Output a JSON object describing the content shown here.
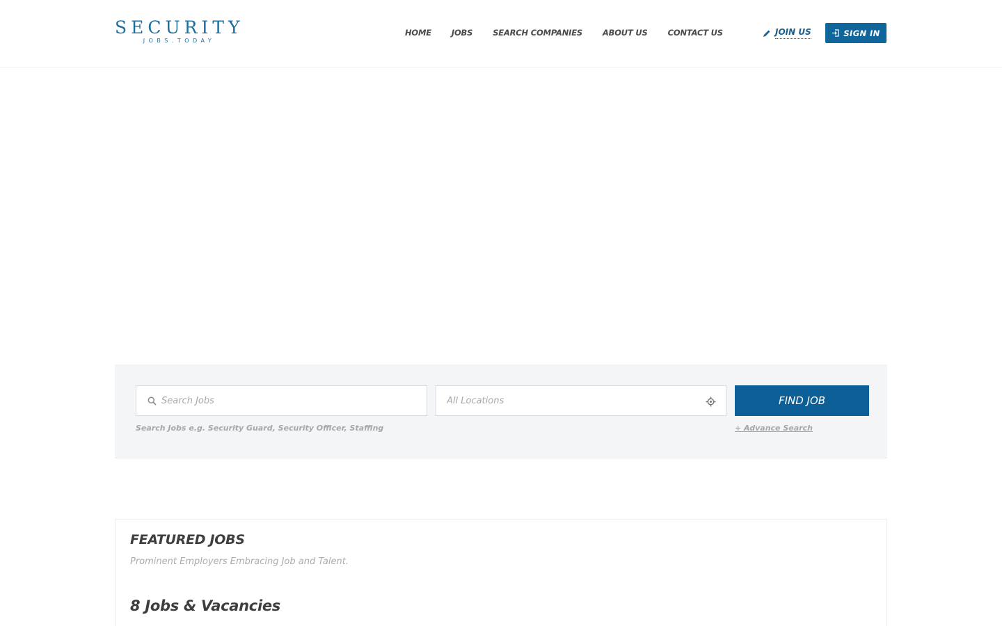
{
  "logo": {
    "main": "SECURITY",
    "sub": "JOBS.TODAY"
  },
  "nav": {
    "items": [
      {
        "label": "HOME"
      },
      {
        "label": "JOBS"
      },
      {
        "label": "SEARCH COMPANIES"
      },
      {
        "label": "ABOUT US"
      },
      {
        "label": "CONTACT US"
      }
    ],
    "join_label": "JOIN US",
    "signin_label": "SIGN IN"
  },
  "search": {
    "jobs_placeholder": "Search Jobs",
    "location_placeholder": "All Locations",
    "find_label": "FIND JOB",
    "hint": "Search Jobs e.g. Security Guard, Security Officer, Staffing",
    "advance_label": "+ Advance Search"
  },
  "featured": {
    "title": "FEATURED JOBS",
    "subtitle": "Prominent Employers Embracing Job and Talent.",
    "count_heading": "8 Jobs & Vacancies"
  },
  "icons": {
    "join": "pencil-icon",
    "signin": "sign-in-icon",
    "search": "search-icon",
    "locate": "crosshair-icon"
  },
  "colors": {
    "brand": "#1f6f9e",
    "button": "#0c5f97",
    "panel_bg": "#f3f5f7"
  }
}
